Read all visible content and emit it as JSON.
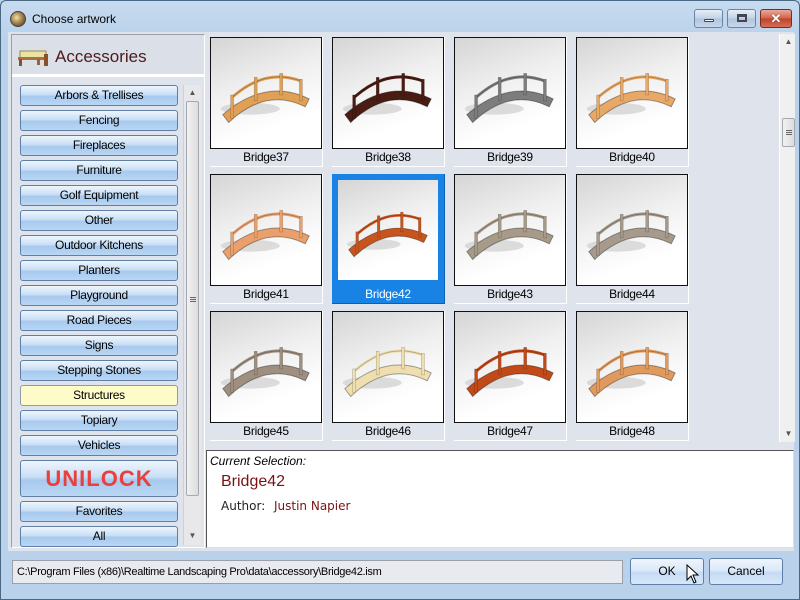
{
  "window": {
    "title": "Choose artwork",
    "controls": {
      "minimize": "minimize",
      "maximize": "maximize",
      "close": "✕"
    }
  },
  "category": {
    "title": "Accessories",
    "icon": "bench-icon",
    "items": [
      {
        "label": "Arbors & Trellises",
        "active": false
      },
      {
        "label": "Fencing",
        "active": false
      },
      {
        "label": "Fireplaces",
        "active": false
      },
      {
        "label": "Furniture",
        "active": false
      },
      {
        "label": "Golf Equipment",
        "active": false
      },
      {
        "label": "Other",
        "active": false
      },
      {
        "label": "Outdoor Kitchens",
        "active": false
      },
      {
        "label": "Planters",
        "active": false
      },
      {
        "label": "Playground",
        "active": false
      },
      {
        "label": "Road Pieces",
        "active": false
      },
      {
        "label": "Signs",
        "active": false
      },
      {
        "label": "Stepping Stones",
        "active": false
      },
      {
        "label": "Structures",
        "active": true
      },
      {
        "label": "Topiary",
        "active": false
      },
      {
        "label": "Vehicles",
        "active": false
      }
    ],
    "brand_button": "UNILOCK",
    "favorites": "Favorites",
    "all": "All"
  },
  "thumbnails": [
    {
      "label": "Bridge37",
      "color": "#e0a055",
      "selected": false
    },
    {
      "label": "Bridge38",
      "color": "#4a1d14",
      "selected": false
    },
    {
      "label": "Bridge39",
      "color": "#7d7d7d",
      "selected": false
    },
    {
      "label": "Bridge40",
      "color": "#e8a868",
      "selected": false
    },
    {
      "label": "Bridge41",
      "color": "#eaa06c",
      "selected": false
    },
    {
      "label": "Bridge42",
      "color": "#c8541e",
      "selected": true
    },
    {
      "label": "Bridge43",
      "color": "#a89a88",
      "selected": false
    },
    {
      "label": "Bridge44",
      "color": "#a59a8c",
      "selected": false
    },
    {
      "label": "Bridge45",
      "color": "#9e8f80",
      "selected": false
    },
    {
      "label": "Bridge46",
      "color": "#f0dfae",
      "selected": false
    },
    {
      "label": "Bridge47",
      "color": "#c24a18",
      "selected": false
    },
    {
      "label": "Bridge48",
      "color": "#e09a5e",
      "selected": false
    }
  ],
  "detail": {
    "current_label": "Current Selection:",
    "name": "Bridge42",
    "author_label": "Author:",
    "author": "Justin Napier"
  },
  "footer": {
    "path": "C:\\Program Files (x86)\\Realtime Landscaping Pro\\data\\accessory\\Bridge42.ism",
    "ok": "OK",
    "cancel": "Cancel"
  }
}
